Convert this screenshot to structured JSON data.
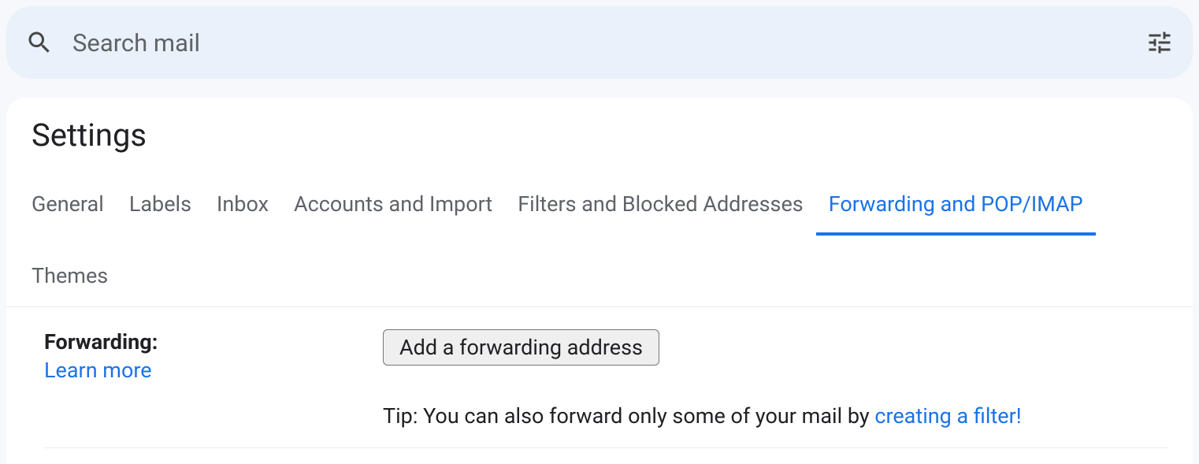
{
  "search": {
    "placeholder": "Search mail"
  },
  "page_title": "Settings",
  "tabs": {
    "general": "General",
    "labels": "Labels",
    "inbox": "Inbox",
    "accounts": "Accounts and Import",
    "filters": "Filters and Blocked Addresses",
    "forwarding": "Forwarding and POP/IMAP",
    "themes": "Themes"
  },
  "forwarding": {
    "section_label": "Forwarding:",
    "learn_more": "Learn more",
    "add_button": "Add a forwarding address",
    "tip_prefix": "Tip: You can also forward only some of your mail by ",
    "tip_link": "creating a filter!"
  }
}
